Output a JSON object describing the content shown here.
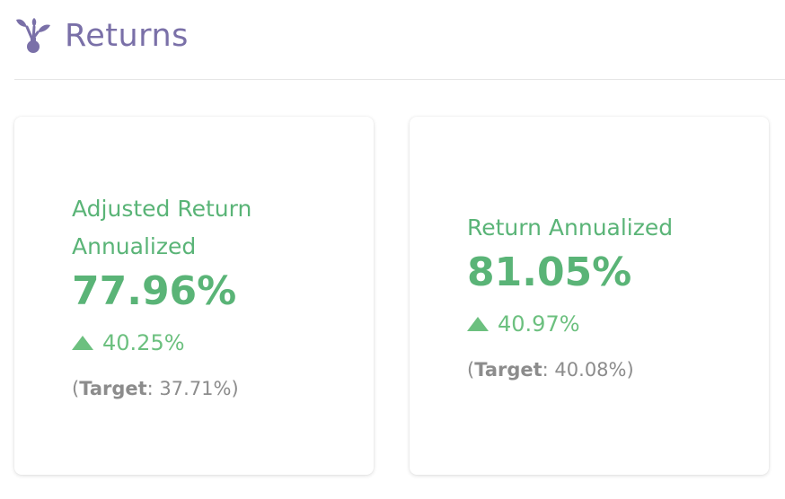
{
  "header": {
    "icon": "sprout-hand-icon",
    "title": "Returns"
  },
  "colors": {
    "title": "#7a70a8",
    "positive": "#5ab477",
    "delta": "#6cc07f",
    "muted": "#8c8c8c"
  },
  "cards": [
    {
      "title_line1": "Adjusted Return",
      "title_line2": "Annualized",
      "value": "77.96%",
      "delta_icon": "triangle-up-icon",
      "delta": "40.25%",
      "target_open": "(",
      "target_label": "Target",
      "target_rest": ": 37.71%)"
    },
    {
      "title_line1": "Return Annualized",
      "value": "81.05%",
      "delta_icon": "triangle-up-icon",
      "delta": "40.97%",
      "target_open": "(",
      "target_label": "Target",
      "target_rest": ": 40.08%)"
    }
  ]
}
